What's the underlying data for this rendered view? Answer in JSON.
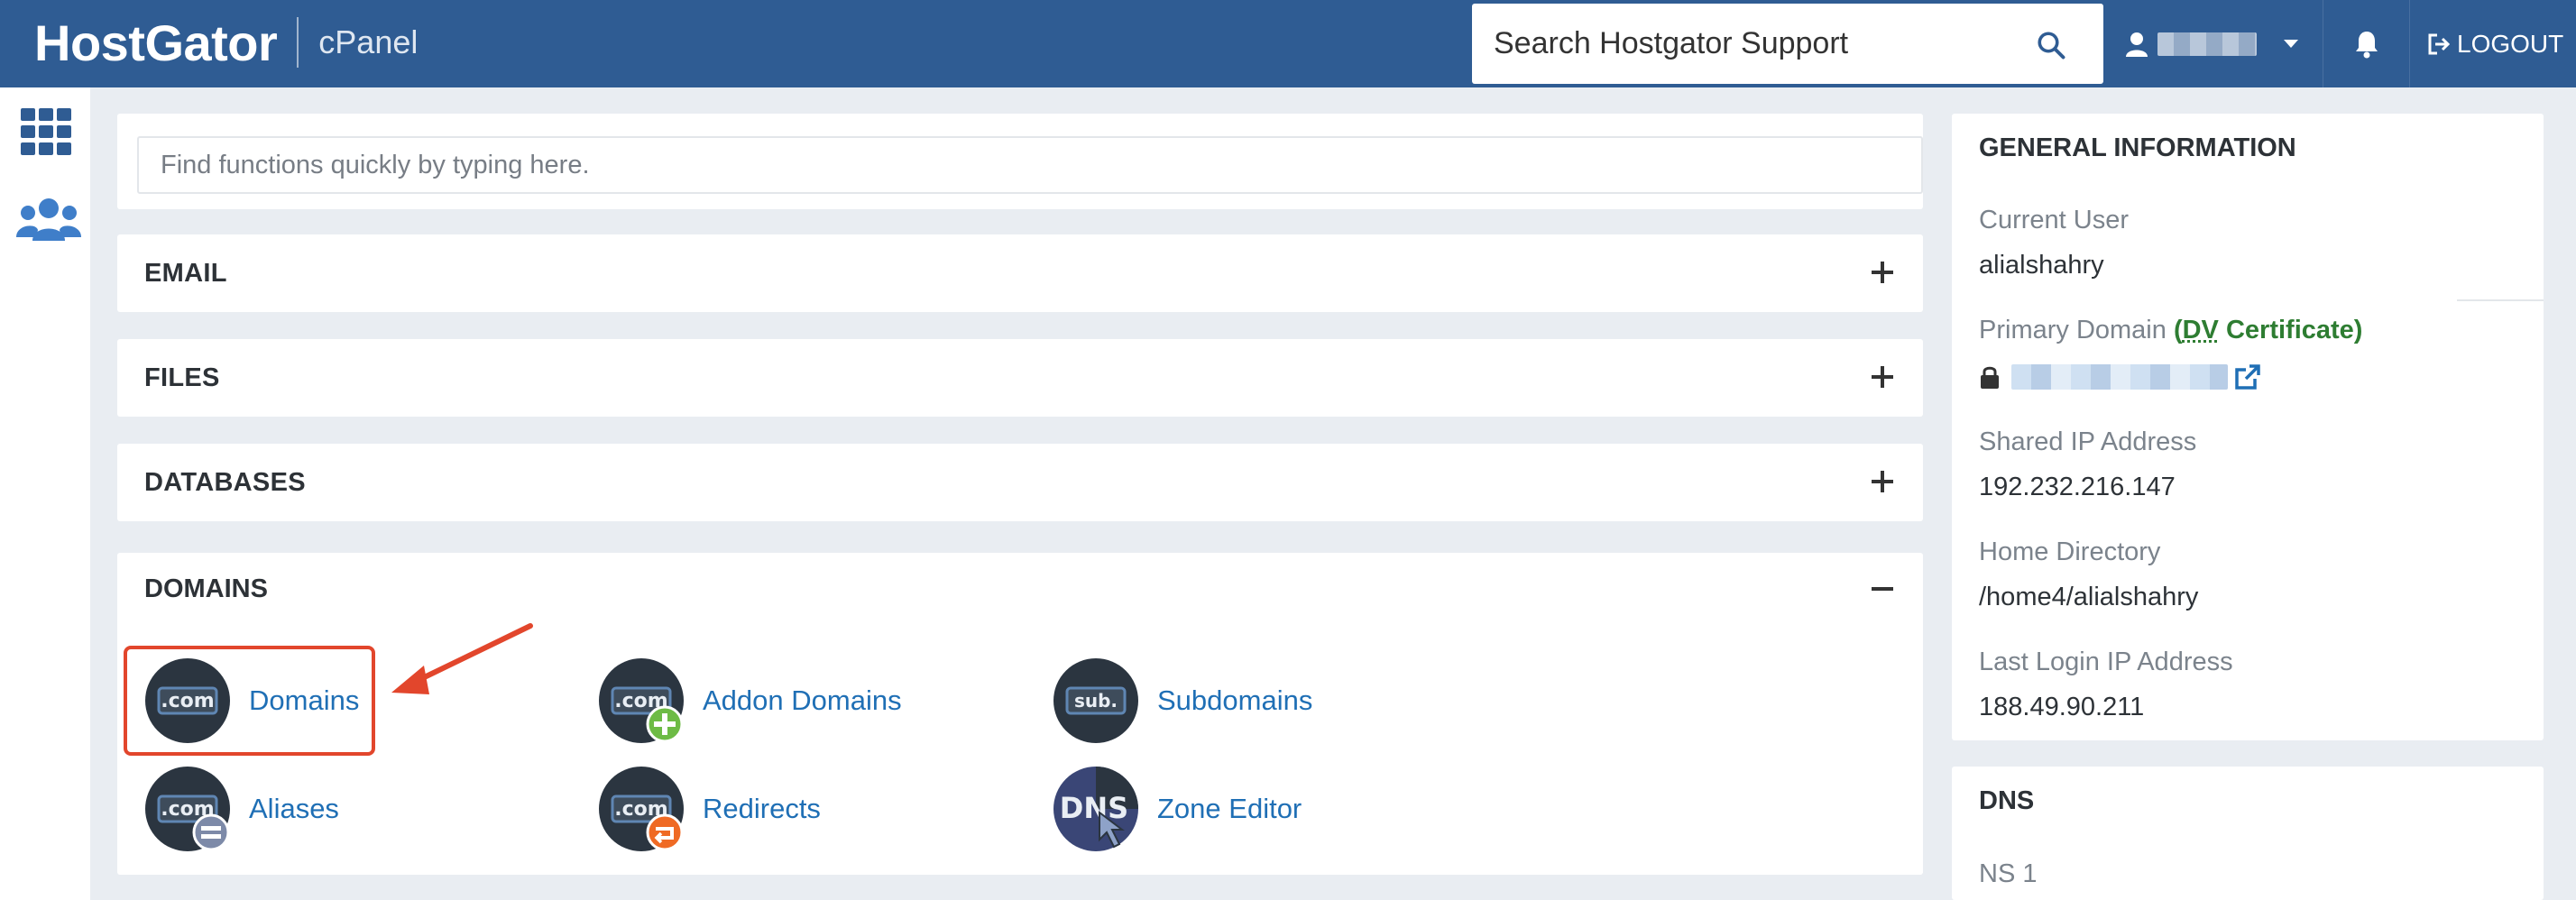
{
  "header": {
    "logo": "HostGator",
    "product": "cPanel",
    "search_placeholder": "Search Hostgator Support",
    "logout_label": "LOGOUT"
  },
  "quick_search": {
    "placeholder": "Find functions quickly by typing here."
  },
  "sections": {
    "email": "EMAIL",
    "files": "FILES",
    "databases": "DATABASES",
    "domains": "DOMAINS"
  },
  "domains_items": [
    {
      "label": "Domains",
      "icon_text": ".com"
    },
    {
      "label": "Addon Domains",
      "icon_text": ".com"
    },
    {
      "label": "Subdomains",
      "icon_text": "sub."
    },
    {
      "label": "Aliases",
      "icon_text": ".com"
    },
    {
      "label": "Redirects",
      "icon_text": ".com"
    },
    {
      "label": "Zone Editor",
      "icon_text": "DNS"
    }
  ],
  "general_info": {
    "heading": "GENERAL INFORMATION",
    "current_user_label": "Current User",
    "current_user": "alialshahry",
    "primary_domain_label": "Primary Domain",
    "certificate_open": "(",
    "certificate_dv": "DV",
    "certificate_rest": " Certificate)",
    "shared_ip_label": "Shared IP Address",
    "shared_ip": "192.232.216.147",
    "home_dir_label": "Home Directory",
    "home_dir": "/home4/alialshahry",
    "last_login_label": "Last Login IP Address",
    "last_login": "188.49.90.211"
  },
  "dns": {
    "heading": "DNS",
    "ns1_label": "NS 1"
  },
  "colors": {
    "topbar": "#2f5c93",
    "link": "#1f6fb5",
    "highlight": "#e2462c",
    "certificate": "#2e7d32"
  }
}
